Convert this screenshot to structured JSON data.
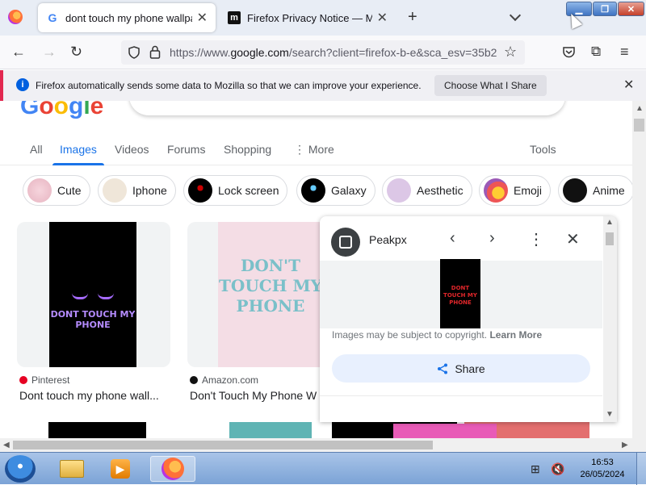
{
  "browser": {
    "tabs": [
      {
        "title": "dont touch my phone wallpape",
        "active": true
      },
      {
        "title": "Firefox Privacy Notice — Mozill",
        "active": false
      }
    ],
    "url_prefix": "https://www.",
    "url_domain": "google.com",
    "url_rest": "/search?client=firefox-b-e&sca_esv=35b2",
    "notification": {
      "text": "Firefox automatically sends some data to Mozilla so that we can improve your experience.",
      "button": "Choose What I Share"
    }
  },
  "search": {
    "tabs": [
      "All",
      "Images",
      "Videos",
      "Forums",
      "Shopping",
      "More",
      "Tools"
    ],
    "active_tab": "Images",
    "chips": [
      "Cute",
      "Iphone",
      "Lock screen",
      "Galaxy",
      "Aesthetic",
      "Emoji",
      "Anime"
    ],
    "results": [
      {
        "source": "Pinterest",
        "title": "Dont touch my phone wall...",
        "image_text": "DONT TOUCH MY PHONE"
      },
      {
        "source": "Amazon.com",
        "title": "Don't Touch My Phone W",
        "image_text": "DON'T TOUCH MY PHONE"
      }
    ]
  },
  "panel": {
    "site": "Peakpx",
    "image_text": "DONT TOUCH MY PHONE",
    "copyright_text": "Images may be subject to copyright.",
    "learn_more": "Learn More",
    "share": "Share"
  },
  "taskbar": {
    "time": "16:53",
    "date": "26/05/2024"
  },
  "colors": {
    "accent_blue": "#1a73e8",
    "firefox_orange": "#ff7139",
    "notification_stripe": "#e22850"
  }
}
